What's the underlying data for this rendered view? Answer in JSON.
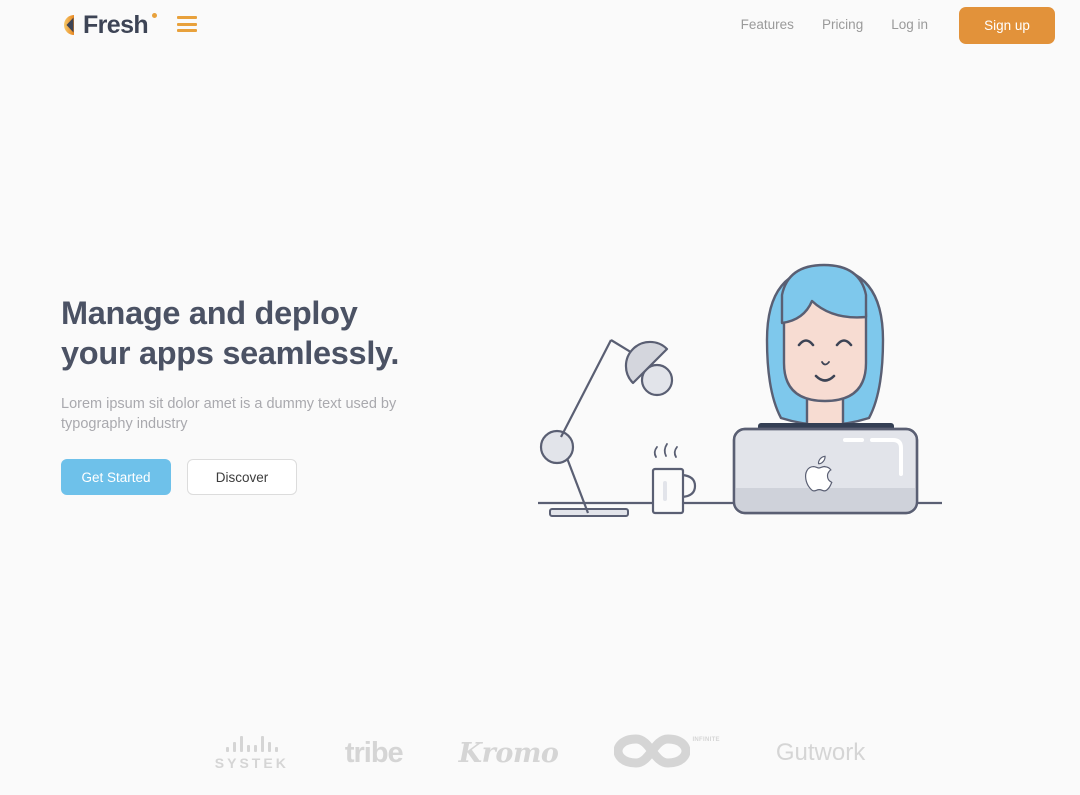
{
  "page": {
    "background_color": "#fafafa"
  },
  "header": {
    "brand": {
      "name": "Fresh",
      "mark_icon": "fresh-circle-chevron-icon",
      "dot_icon": "brand-dot-icon",
      "accent_color": "#e8a13c",
      "text_color": "#3d4455"
    },
    "menu_icon": "hamburger-menu-icon",
    "nav_links": [
      {
        "label": "Features"
      },
      {
        "label": "Pricing"
      },
      {
        "label": "Log in"
      }
    ],
    "signup_label": "Sign up",
    "signup_color": "#e2923a"
  },
  "hero": {
    "title_line1": "Manage and deploy",
    "title_line2": "your apps seamlessly.",
    "title_color": "#4b5264",
    "subtitle": "Lorem ipsum sit dolor amet is a dummy text used by typography industry",
    "primary_cta": "Get Started",
    "primary_cta_color": "#6ec1ea",
    "secondary_cta": "Discover"
  },
  "illustration": {
    "name": "woman-at-laptop-with-desk-lamp-illustration",
    "hair_color": "#7ec8ec",
    "skin_color": "#f7dcd2",
    "outline_color": "#5a5f73",
    "shirt_color": "#343f54",
    "laptop_color": "#e2e4ea",
    "items": [
      "desk-lamp",
      "coffee-mug",
      "laptop",
      "person"
    ]
  },
  "logos": {
    "color": "#d5d5d5",
    "items": [
      {
        "name": "systek",
        "label": "SYSTEK",
        "icon": "systek-bars-icon"
      },
      {
        "name": "tribe",
        "label": "tribe"
      },
      {
        "name": "kromo",
        "label": "Kromo"
      },
      {
        "name": "infinite",
        "label": "INFINITE",
        "icon": "infinity-icon"
      },
      {
        "name": "gutwork",
        "label": "Gutwork"
      }
    ]
  }
}
